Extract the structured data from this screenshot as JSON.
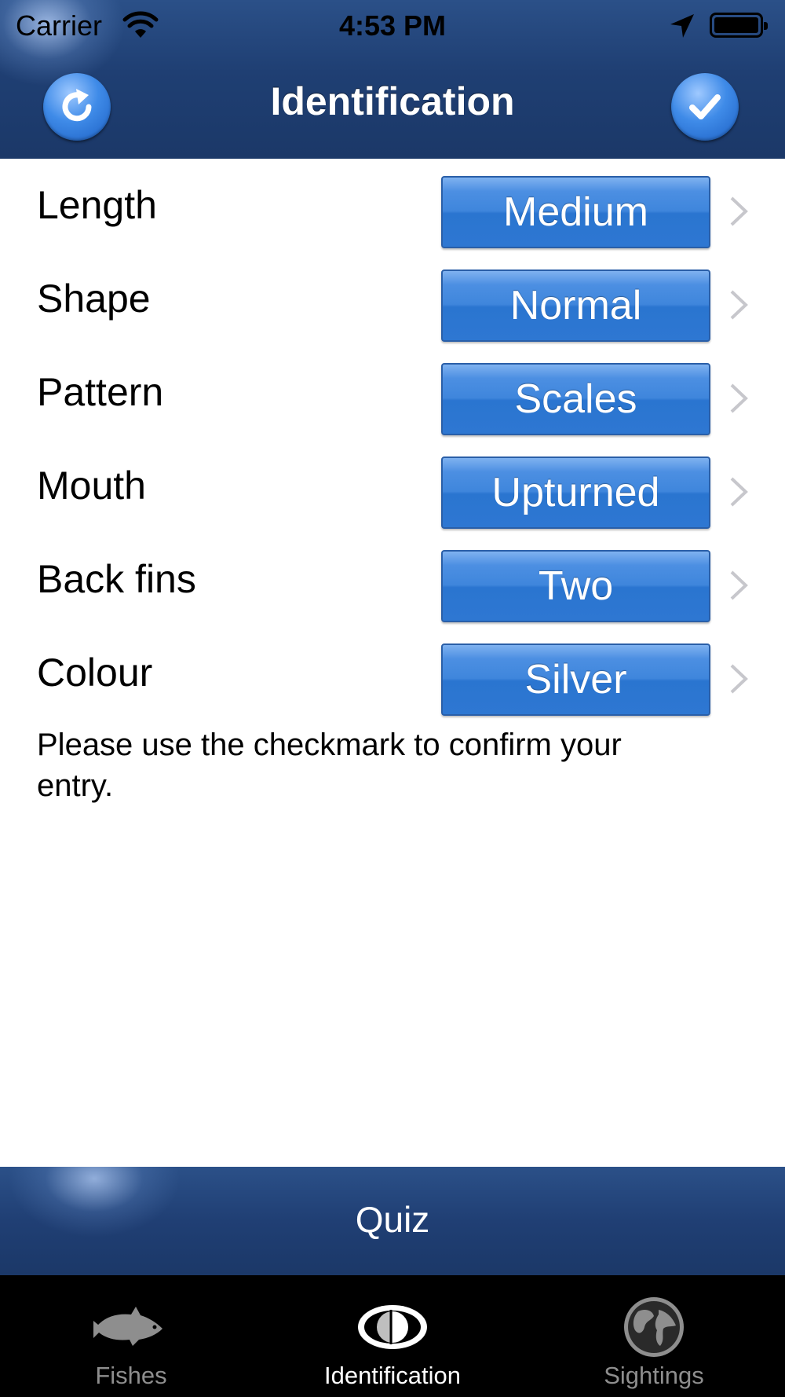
{
  "status_bar": {
    "carrier": "Carrier",
    "time": "4:53 PM",
    "wifi_icon": "wifi-icon",
    "location_icon": "location-arrow-icon",
    "battery_icon": "battery-icon"
  },
  "nav": {
    "title": "Identification",
    "left_button_icon": "refresh-icon",
    "right_button_icon": "checkmark-icon"
  },
  "attributes": [
    {
      "label": "Length",
      "value": "Medium"
    },
    {
      "label": "Shape",
      "value": "Normal"
    },
    {
      "label": "Pattern",
      "value": "Scales"
    },
    {
      "label": "Mouth",
      "value": "Upturned"
    },
    {
      "label": "Back fins",
      "value": "Two"
    },
    {
      "label": "Colour",
      "value": "Silver"
    }
  ],
  "hint": "Please use the checkmark to confirm your entry.",
  "quiz": {
    "label": "Quiz"
  },
  "tabs": [
    {
      "label": "Fishes",
      "icon": "fish-icon",
      "active": false
    },
    {
      "label": "Identification",
      "icon": "eye-icon",
      "active": true
    },
    {
      "label": "Sightings",
      "icon": "globe-icon",
      "active": false
    }
  ],
  "colors": {
    "header_blue": "#1f3f73",
    "button_blue": "#3f86dc",
    "tabbar_black": "#000000",
    "tab_inactive": "#8e8e8e"
  }
}
